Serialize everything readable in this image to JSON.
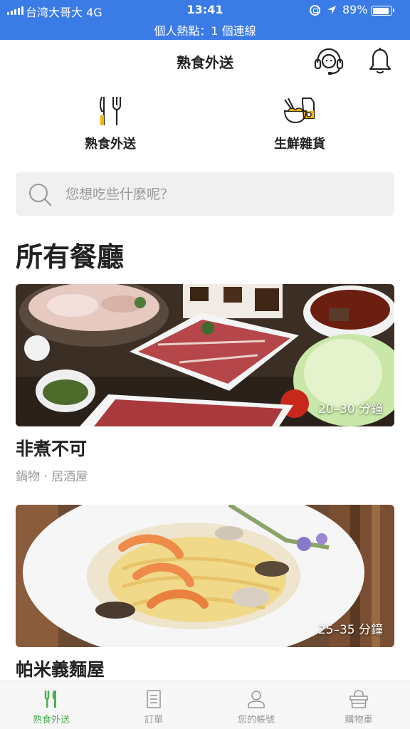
{
  "status_bar": {
    "carrier": "台湾大哥大  4G",
    "time": "13:41",
    "battery_percent": "89%",
    "battery_level": 0.89,
    "hotspot": "個人熱點：1 個連線",
    "color": "#3b7be6"
  },
  "header": {
    "title": "熟食外送",
    "icons": [
      "headset-icon",
      "bell-icon"
    ]
  },
  "categories": [
    {
      "label": "熟食外送",
      "icon": "utensils-icon"
    },
    {
      "label": "生鮮雜貨",
      "icon": "grocery-bowl-icon"
    }
  ],
  "search": {
    "placeholder": "您想吃些什麼呢？"
  },
  "section_title": "所有餐廳",
  "restaurants": [
    {
      "name": "非煮不可",
      "tags": "鍋物 · 居酒屋",
      "eta": "20–30 分鐘"
    },
    {
      "name": "帕米義麵屋",
      "eta": "25–35 分鐘"
    }
  ],
  "bottom_nav": [
    {
      "label": "熟食外送",
      "icon": "utensils-icon",
      "active": true
    },
    {
      "label": "訂單",
      "icon": "receipt-icon",
      "active": false
    },
    {
      "label": "您的帳號",
      "icon": "person-icon",
      "active": false
    },
    {
      "label": "購物車",
      "icon": "basket-icon",
      "active": false
    }
  ],
  "colors": {
    "accent_green": "#4caf50",
    "text_primary": "#222222",
    "text_muted": "#999999"
  }
}
